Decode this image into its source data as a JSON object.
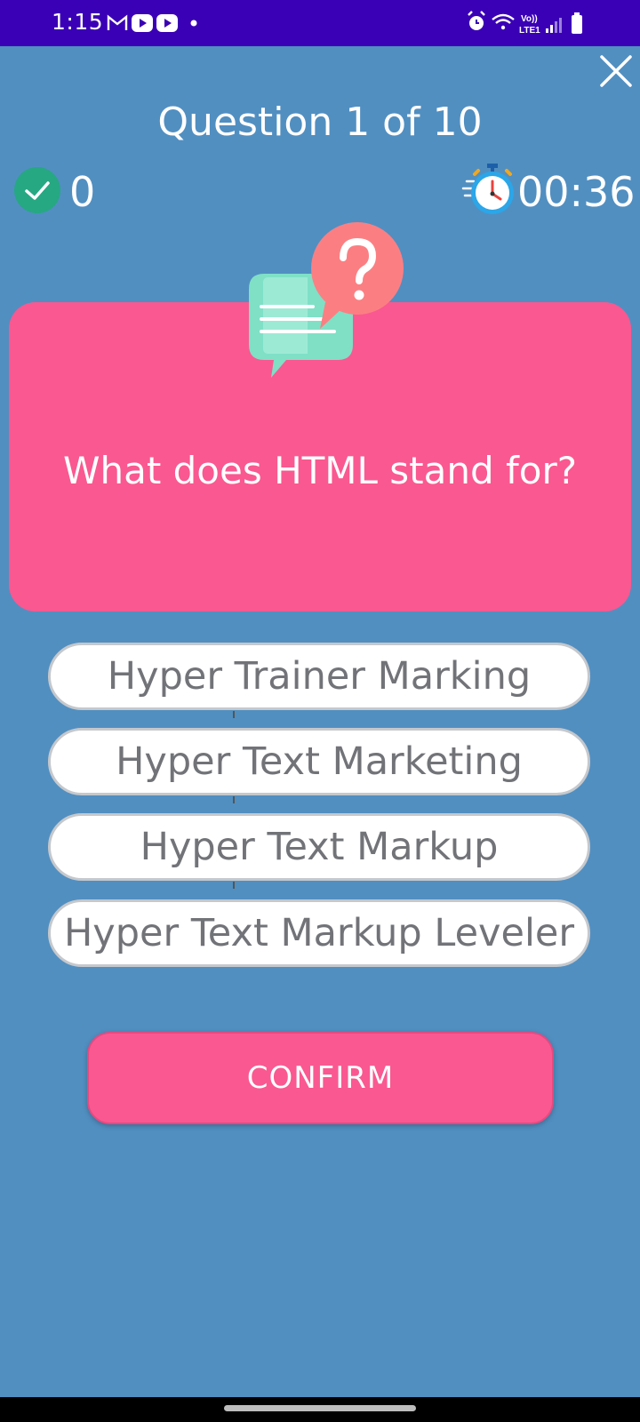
{
  "status_bar": {
    "time": "1:15",
    "left_icons": [
      "gmail-icon",
      "youtube-icon",
      "youtube-icon",
      "dot-icon"
    ],
    "right_icons": [
      "alarm-icon",
      "wifi-icon",
      "volte-icon",
      "signal-icon",
      "battery-icon"
    ],
    "volte_label": "Vo))",
    "lte_label": "LTE1"
  },
  "quiz": {
    "counter": "Question 1 of 10",
    "score": "0",
    "timer": "00:36",
    "question": "What does HTML stand for?",
    "options": [
      "Hyper Trainer Marking",
      "Hyper Text Marketing",
      "Hyper Text Markup",
      "Hyper Text Markup Leveler"
    ],
    "confirm_label": "CONFIRM"
  },
  "colors": {
    "background": "#518FC1",
    "status_bar": "#3A00B5",
    "accent_pink": "#FA5890",
    "option_text": "#727378",
    "check_green": "#26A883"
  }
}
